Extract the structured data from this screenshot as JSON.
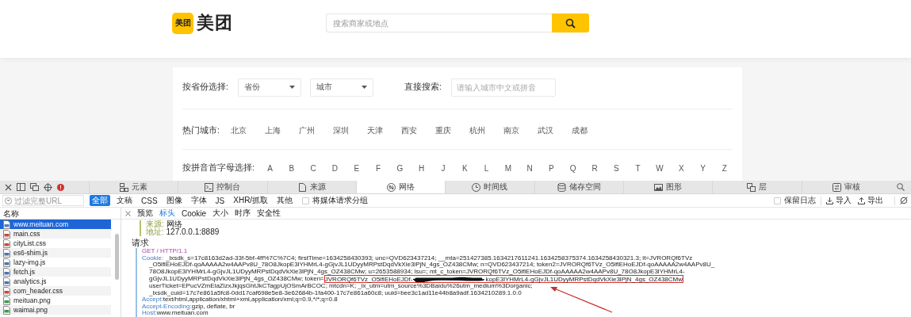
{
  "site": {
    "logo_badge": "美团",
    "logo_text": "美团",
    "search_placeholder": "搜索商家或地点"
  },
  "city_picker": {
    "province_label": "按省份选择:",
    "province_select": "省份",
    "city_select": "城市",
    "search_label": "直接搜索:",
    "search_placeholder": "请输入城市中文或拼音",
    "hot_label": "热门城市:",
    "hot_cities": [
      "北京",
      "上海",
      "广州",
      "深圳",
      "天津",
      "西安",
      "重庆",
      "杭州",
      "南京",
      "武汉",
      "成都"
    ],
    "letter_label": "按拼音首字母选择:",
    "letters": [
      "A",
      "B",
      "C",
      "D",
      "E",
      "F",
      "G",
      "H",
      "J",
      "K",
      "L",
      "M",
      "N",
      "P",
      "Q",
      "R",
      "S",
      "T",
      "W",
      "X",
      "Y",
      "Z"
    ]
  },
  "devtools": {
    "tabs": [
      {
        "label": "元素",
        "selected": false,
        "kind": "elements"
      },
      {
        "label": "控制台",
        "selected": false,
        "kind": "console"
      },
      {
        "label": "来源",
        "selected": false,
        "kind": "sources"
      },
      {
        "label": "网络",
        "selected": true,
        "kind": "network"
      },
      {
        "label": "时间线",
        "selected": false,
        "kind": "timeline"
      },
      {
        "label": "储存空间",
        "selected": false,
        "kind": "storage"
      },
      {
        "label": "图形",
        "selected": false,
        "kind": "graphics"
      },
      {
        "label": "层",
        "selected": false,
        "kind": "layers"
      },
      {
        "label": "审核",
        "selected": false,
        "kind": "audit"
      }
    ],
    "filter": {
      "placeholder": "过滤完整URL",
      "types": [
        {
          "label": "全部",
          "selected": true
        },
        {
          "label": "文稿",
          "selected": false
        },
        {
          "label": "CSS",
          "selected": false
        },
        {
          "label": "图像",
          "selected": false
        },
        {
          "label": "字体",
          "selected": false
        },
        {
          "label": "JS",
          "selected": false
        },
        {
          "label": "XHR/抓取",
          "selected": false
        },
        {
          "label": "其他",
          "selected": false
        }
      ],
      "group_media": {
        "label": "将媒体请求分组",
        "checked": false
      },
      "preserve_log": {
        "label": "保留日志",
        "checked": false
      },
      "import": "导入",
      "export": "导出"
    },
    "resources": {
      "header": "名称",
      "items": [
        {
          "name": "www.meituan.com",
          "kind": "html",
          "selected": true
        },
        {
          "name": "main.css",
          "kind": "css",
          "selected": false
        },
        {
          "name": "cityList.css",
          "kind": "css",
          "selected": false
        },
        {
          "name": "es6-shim.js",
          "kind": "js",
          "selected": false
        },
        {
          "name": "lazy-img.js",
          "kind": "js",
          "selected": false
        },
        {
          "name": "fetch.js",
          "kind": "js",
          "selected": false
        },
        {
          "name": "analytics.js",
          "kind": "js",
          "selected": false
        },
        {
          "name": "com_header.css",
          "kind": "css",
          "selected": false
        },
        {
          "name": "meituan.png",
          "kind": "png",
          "selected": false
        },
        {
          "name": "waimai.png",
          "kind": "png",
          "selected": false
        }
      ]
    },
    "detail_tabs": [
      {
        "label": "预览",
        "selected": false
      },
      {
        "label": "标头",
        "selected": true
      },
      {
        "label": "Cookie",
        "selected": false
      },
      {
        "label": "大小",
        "selected": false
      },
      {
        "label": "时序",
        "selected": false
      },
      {
        "label": "安全性",
        "selected": false
      }
    ],
    "summary": [
      {
        "key": "来源:",
        "value": "网络"
      },
      {
        "key": "地址:",
        "value": "127.0.0.1:8889"
      }
    ],
    "request_title": "请求",
    "request_line": "GET / HTTP/1.1",
    "cookie": {
      "name": "Cookie:",
      "lines": [
        [
          {
            "kind": "text",
            "text": "_lxsdk_s=17c8163d2ad-33f-5bf-4ff%7C%7C4; firstTime=1634258430393; unc=QVD623437214; __mta=251427385.1634217611241.1634258375374.1634258430321.3; lt=JVRORQf6TVz"
          }
        ],
        [
          {
            "kind": "text",
            "text": "_O5lflEHoEJDf-qoAAAAA2w4AAPv8U_78O8JkopE3lYHMrL4-gGjvJL1UDyyMRPstDqdVkXie3lPjN_4gs_OZ438CMw; n=QVD623437214; token2=JVRORQf6TVz_O5lflEHoEJDf-qoAAAAA2w4AAPv8U_"
          }
        ],
        [
          {
            "kind": "text",
            "text": "78O8JkopE3lYHMrL4-gGjvJL1UDyyMRPstDqdVkXie3lPjN_4gs_OZ438CMw; u=2653588934; lsu=; mt_c_token=JVRORQf6TVz_O5lflEHoEJDf-qoAAAAA2w4AAPv8U_78O8JkopE3lYHMrL4-"
          }
        ],
        [
          {
            "kind": "text",
            "text": "gGjvJL1UDyyMRPstDqdVkXie3lPjN_4gs_OZ438CMw; token="
          },
          {
            "kind": "box",
            "parts": [
              "JVRORQf6TVz_O5lflEHoEJDf-",
              "kopE3lYHMrL4-gGjvJL1UDyyMRPstDqdVkXie3lPjN_4gs_OZ438CMw"
            ]
          }
        ],
        [
          {
            "kind": "text",
            "text": "userTicket=EPucVZmElaZlzxJkjqsGhtJkCTagpUjOSmArBCOC; mtcdn=K; _lx_utm=utm_source%3DBaidu%26utm_medium%3Dorganic;"
          }
        ],
        [
          {
            "kind": "text",
            "text": "_lxsdk_cuid=17c7e861a5fc8-0dd17caf698e5e8-3e62684b-1fa400-17c7e861a60c8; uuid=bee3c1ad11e44b8a9adf.1634210289.1.0.0"
          }
        ]
      ]
    },
    "headers": [
      {
        "name": "Accept:",
        "value": "text/html,application/xhtml+xml,application/xml;q=0.9,*/*;q=0.8"
      },
      {
        "name": "Accept-Encoding:",
        "value": "gzip, deflate, br"
      },
      {
        "name": "Host:",
        "value": "www.meituan.com"
      }
    ]
  }
}
